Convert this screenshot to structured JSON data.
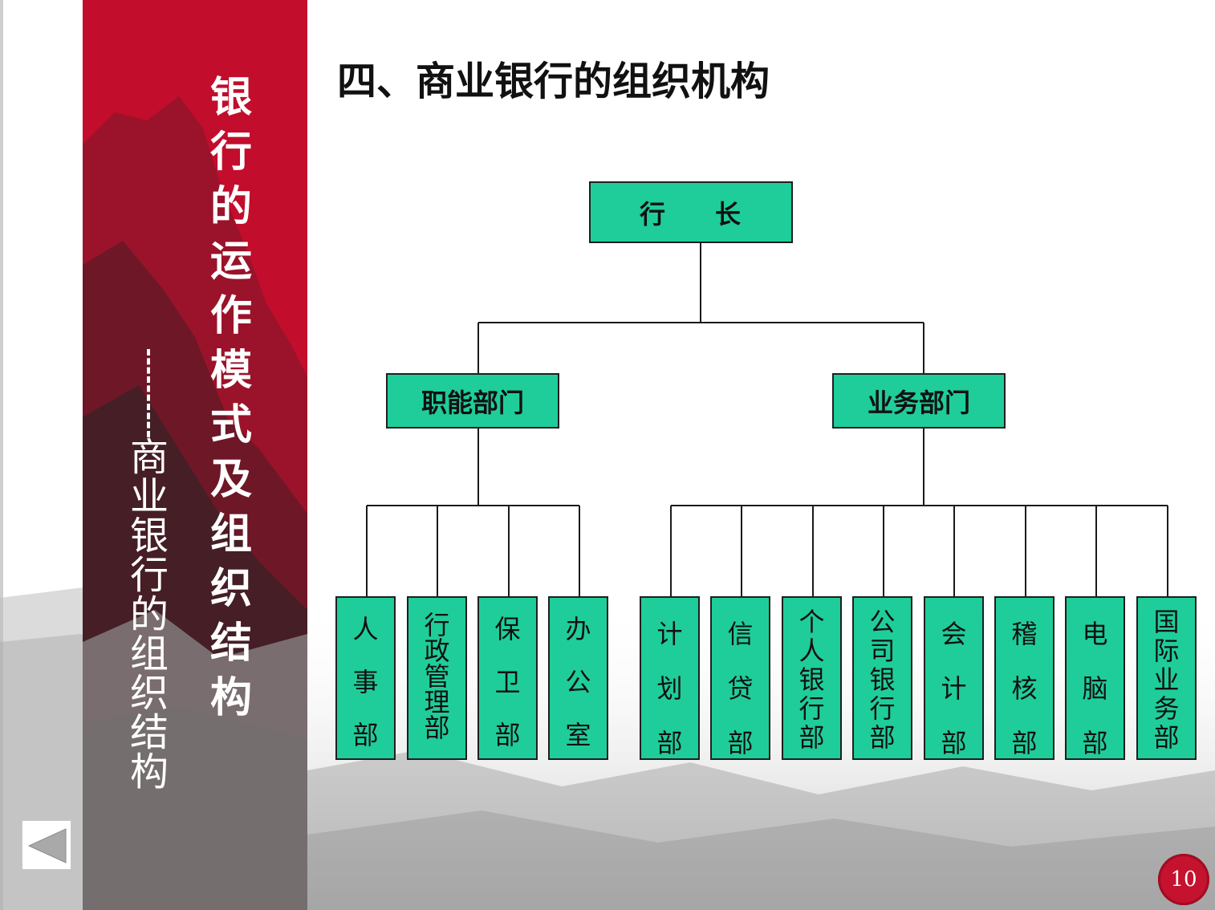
{
  "sidebar": {
    "title_chars": [
      "银",
      "行",
      "的",
      "运",
      "作",
      "模",
      "式",
      "及",
      "组",
      "织",
      "结",
      "构"
    ],
    "subtitle_chars": [
      "商",
      "业",
      "银",
      "行",
      "的",
      "组",
      "织",
      "结",
      "构"
    ]
  },
  "page": {
    "title": "四、商业银行的组织机构",
    "number": "10"
  },
  "org": {
    "root": {
      "left": "行",
      "right": "长"
    },
    "branches": [
      {
        "label": "职能部门",
        "children": [
          [
            "人",
            "事",
            "部"
          ],
          [
            "行",
            "政",
            "管",
            "理",
            "部"
          ],
          [
            "保",
            "卫",
            "部"
          ],
          [
            "办",
            "公",
            "室"
          ]
        ]
      },
      {
        "label": "业务部门",
        "children": [
          [
            "计",
            "划",
            "部"
          ],
          [
            "信",
            "贷",
            "部"
          ],
          [
            "个",
            "人",
            "银",
            "行",
            "部"
          ],
          [
            "公",
            "司",
            "银",
            "行",
            "部"
          ],
          [
            "会",
            "计",
            "部"
          ],
          [
            "稽",
            "核",
            "部"
          ],
          [
            "电",
            "脑",
            "部"
          ],
          [
            "国",
            "际",
            "业",
            "务",
            "部"
          ]
        ]
      }
    ]
  },
  "colors": {
    "banner": "#c20d2c",
    "node_fill": "#1fcd9a",
    "page_badge": "#c4122f"
  },
  "icons": {
    "back": "left-triangle-icon"
  }
}
